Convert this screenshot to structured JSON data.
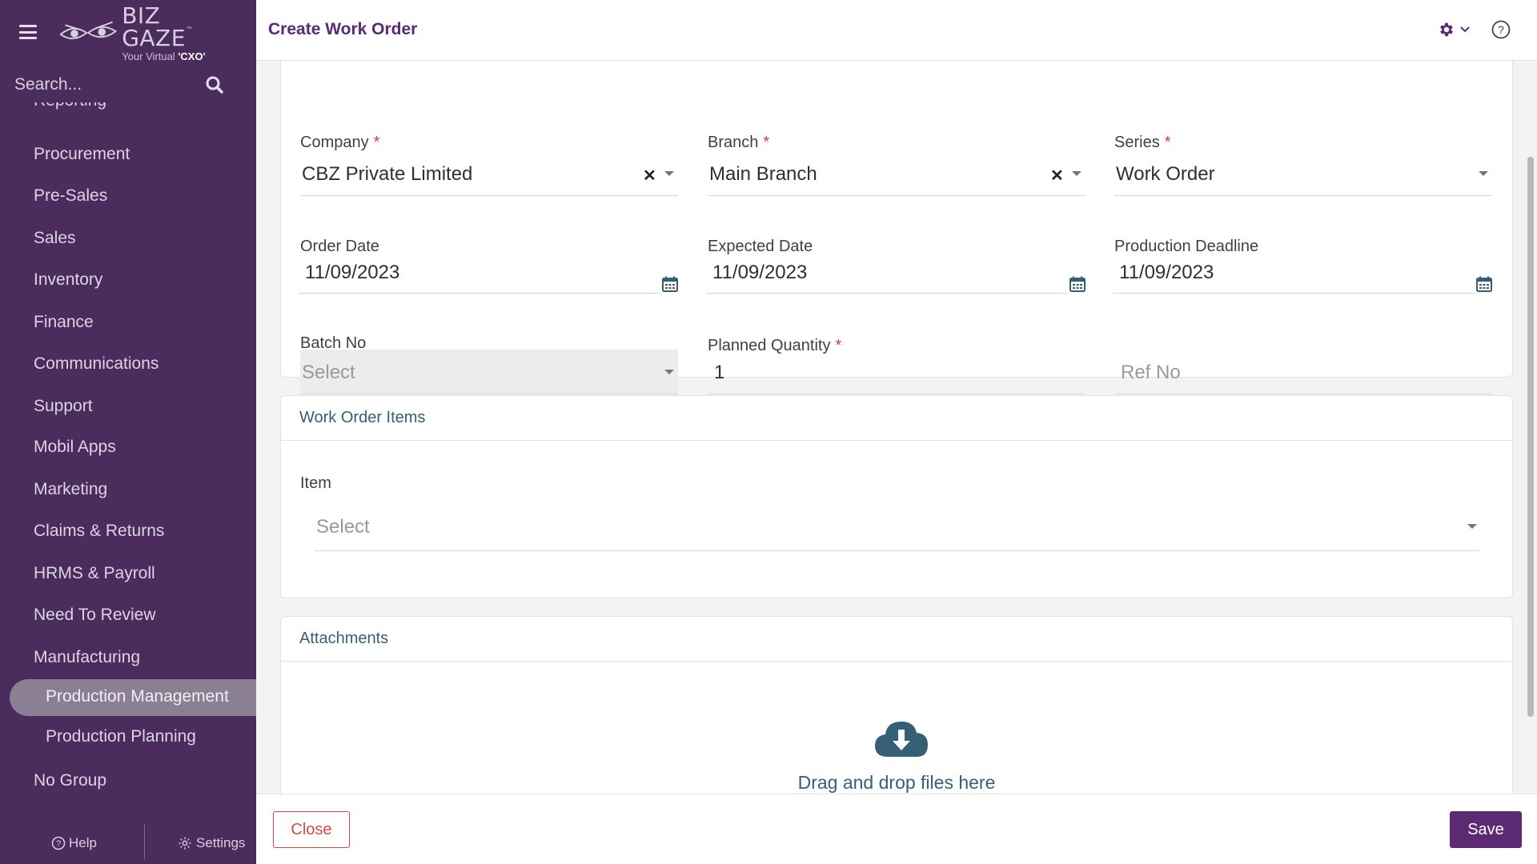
{
  "brand": {
    "name": "BIZ GAZE",
    "trademark": "™",
    "tagline_prefix": "Your Virtual ",
    "tagline_emphasis": "'CXO'",
    "accent_color": "#5b2a73",
    "sidebar_color": "#4a2d5c"
  },
  "sidebar": {
    "search_placeholder": "Search...",
    "partial_item": "Reporting",
    "items": [
      {
        "label": "Procurement"
      },
      {
        "label": "Pre-Sales"
      },
      {
        "label": "Sales"
      },
      {
        "label": "Inventory"
      },
      {
        "label": "Finance"
      },
      {
        "label": "Communications"
      },
      {
        "label": "Support"
      },
      {
        "label": "Mobil Apps"
      },
      {
        "label": "Marketing"
      },
      {
        "label": "Claims & Returns"
      },
      {
        "label": "HRMS & Payroll"
      },
      {
        "label": "Need To Review"
      },
      {
        "label": "Manufacturing"
      }
    ],
    "sub_items": [
      {
        "label": "Production Management",
        "active": true
      },
      {
        "label": "Production Planning",
        "active": false
      }
    ],
    "last_item": "No Group",
    "help_label": "Help",
    "settings_label": "Settings"
  },
  "header": {
    "title": "Create Work Order"
  },
  "form": {
    "company": {
      "label": "Company",
      "value": "CBZ Private Limited",
      "required": true
    },
    "branch": {
      "label": "Branch",
      "value": "Main Branch",
      "required": true
    },
    "series": {
      "label": "Series",
      "value": "Work Order",
      "required": true
    },
    "order_date": {
      "label": "Order Date",
      "value": "11/09/2023"
    },
    "expected_date": {
      "label": "Expected Date",
      "value": "11/09/2023"
    },
    "production_deadline": {
      "label": "Production Deadline",
      "value": "11/09/2023"
    },
    "batch_no": {
      "label": "Batch No",
      "placeholder": "Select"
    },
    "planned_quantity": {
      "label": "Planned Quantity",
      "value": "1",
      "required": true
    },
    "ref_no": {
      "placeholder": "Ref No"
    },
    "required_marker": "*"
  },
  "items_section": {
    "title": "Work Order Items",
    "item_label": "Item",
    "item_placeholder": "Select"
  },
  "attachments": {
    "title": "Attachments",
    "dropzone_text": "Drag and drop files here"
  },
  "footer": {
    "close_label": "Close",
    "save_label": "Save"
  }
}
